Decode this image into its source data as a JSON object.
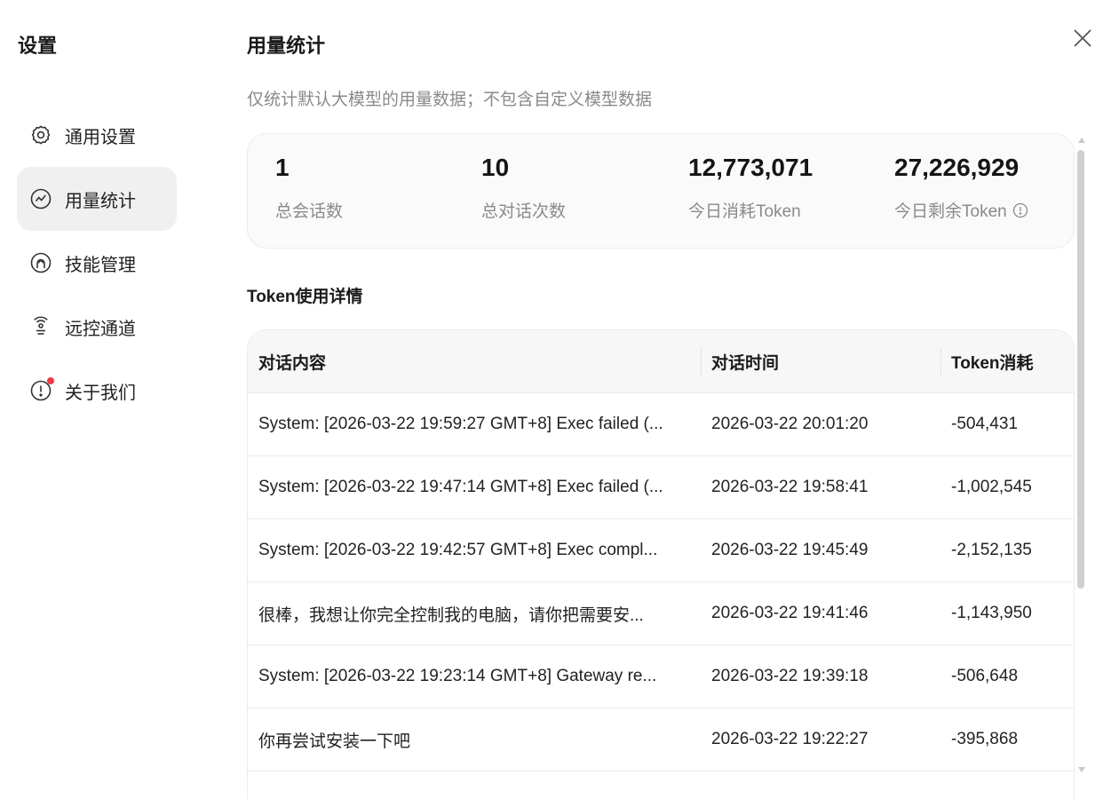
{
  "sidebar": {
    "title": "设置",
    "items": [
      {
        "label": "通用设置",
        "icon": "gear-icon"
      },
      {
        "label": "用量统计",
        "icon": "chart-icon",
        "active": true
      },
      {
        "label": "技能管理",
        "icon": "skill-icon"
      },
      {
        "label": "远控通道",
        "icon": "remote-icon"
      },
      {
        "label": "关于我们",
        "icon": "alert-icon",
        "badge": "red-dot"
      }
    ]
  },
  "main": {
    "title": "用量统计",
    "subtitle": "仅统计默认大模型的用量数据；不包含自定义模型数据",
    "stats": [
      {
        "value": "1",
        "label": "总会话数"
      },
      {
        "value": "10",
        "label": "总对话次数"
      },
      {
        "value": "12,773,071",
        "label": "今日消耗Token"
      },
      {
        "value": "27,226,929",
        "label": "今日剩余Token"
      }
    ],
    "section_title": "Token使用详情",
    "table": {
      "headers": [
        "对话内容",
        "对话时间",
        "Token消耗"
      ],
      "rows": [
        [
          "System: [2026-03-22 19:59:27 GMT+8] Exec failed (...",
          "2026-03-22 20:01:20",
          "-504,431"
        ],
        [
          "System: [2026-03-22 19:47:14 GMT+8] Exec failed (...",
          "2026-03-22 19:58:41",
          "-1,002,545"
        ],
        [
          "System: [2026-03-22 19:42:57 GMT+8] Exec compl...",
          "2026-03-22 19:45:49",
          "-2,152,135"
        ],
        [
          "很棒，我想让你完全控制我的电脑，请你把需要安...",
          "2026-03-22 19:41:46",
          "-1,143,950"
        ],
        [
          "System: [2026-03-22 19:23:14 GMT+8] Gateway re...",
          "2026-03-22 19:39:18",
          "-506,648"
        ],
        [
          "你再尝试安装一下吧",
          "2026-03-22 19:22:27",
          "-395,868"
        ]
      ]
    }
  },
  "colors": {
    "active_bg": "#f0f0f0",
    "badge": "#f0394a",
    "muted_text": "#8a8a8a"
  }
}
